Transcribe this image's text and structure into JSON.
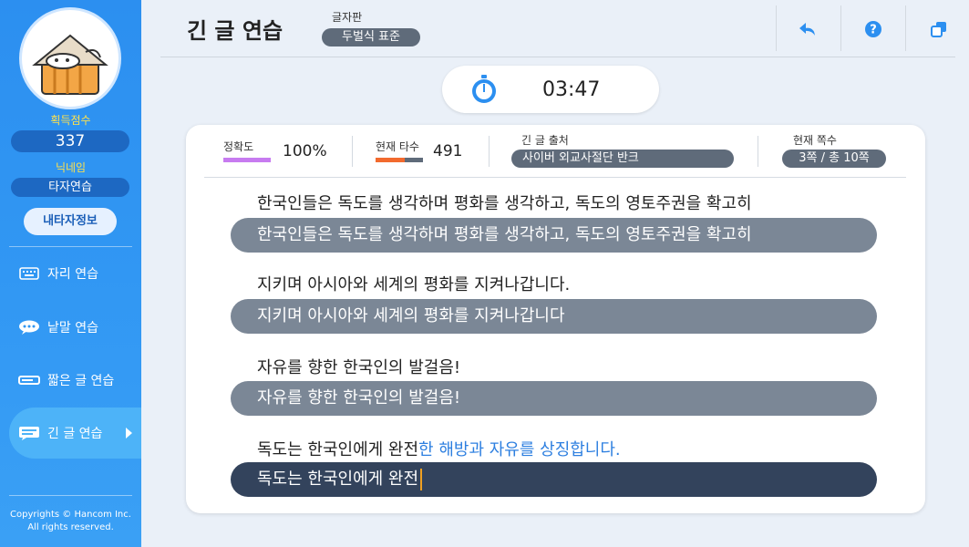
{
  "sidebar": {
    "score_label": "획득점수",
    "score_value": "337",
    "nick_label": "닉네임",
    "nick_value": "타자연습",
    "info_button": "내타자정보",
    "menu": [
      {
        "label": "자리 연습",
        "icon": "keyboard-icon"
      },
      {
        "label": "낱말 연습",
        "icon": "speech-bubble-icon"
      },
      {
        "label": "짧은 글 연습",
        "icon": "short-text-icon"
      },
      {
        "label": "긴 글 연습",
        "icon": "long-text-icon",
        "active": true
      }
    ],
    "copyright_line1": "Copyrights © Hancom Inc.",
    "copyright_line2": "All rights reserved."
  },
  "header": {
    "title": "긴 글 연습",
    "keyboard_label": "글자판",
    "keyboard_value": "두벌식 표준",
    "buttons": [
      "back-icon",
      "help-icon",
      "window-icon"
    ]
  },
  "timer": {
    "value": "03:47"
  },
  "stats": {
    "accuracy_label": "정확도",
    "accuracy_value": "100%",
    "speed_label": "현재 타수",
    "speed_value": "491",
    "source_label": "긴 글 출처",
    "source_value": "사이버 외교사절단 반크",
    "page_label": "현재 쪽수",
    "page_value": "3쪽 / 총 10쪽"
  },
  "lines": [
    {
      "ref": "한국인들은 독도를 생각하며 평화를 생각하고, 독도의 영토주권을 확고히",
      "typed": "한국인들은 독도를 생각하며 평화를 생각하고, 독도의 영토주권을 확고히"
    },
    {
      "ref": "지키며 아시아와 세계의 평화를 지켜나갑니다.",
      "typed": "지키며 아시아와 세계의 평화를 지켜나갑니다"
    },
    {
      "ref": "자유를 향한 한국인의 발걸음!",
      "typed": "자유를 향한 한국인의 발걸음!"
    },
    {
      "ref_done": "독도는 한국인에게 완전",
      "ref_remaining": "한 해방과 자유를 상징합니다.",
      "typed": "독도는 한국인에게 완전"
    }
  ],
  "colors": {
    "accent": "#2c8ff0",
    "accuracy_bar": "#c77bf0",
    "speed_bar_1": "#f26a2e",
    "speed_bar_2": "#5f6b7a",
    "caret": "#f0a021"
  }
}
